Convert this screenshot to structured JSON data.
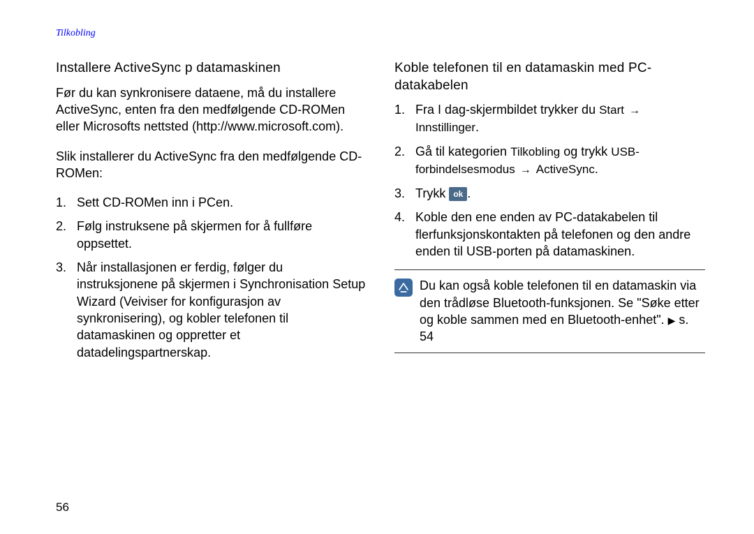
{
  "header": {
    "section_label": "Tilkobling"
  },
  "left": {
    "subheading": "Installere ActiveSync p datamaskinen",
    "intro": "Før du kan synkronisere dataene, må du installere ActiveSync, enten fra den medfølgende CD-ROMen eller Microsofts nettsted (http://www.microsoft.com).",
    "lead_in": "Slik installerer du ActiveSync fra den medfølgende CD-ROMen:",
    "steps": {
      "s1": "Sett CD-ROMen inn i PCen.",
      "s2": "Følg instruksene på skjermen for å fullføre oppsettet.",
      "s3": "Når installasjonen er ferdig, følger du instruksjonene på skjermen i Synchronisation Setup Wizard (Veiviser for konfigurasjon av synkronisering), og kobler telefonen til datamaskinen og oppretter et datadelingspartnerskap."
    }
  },
  "right": {
    "subheading": "Koble telefonen til en datamaskin med PC-datakabelen",
    "step1": {
      "pre": "Fra I dag-skjermbildet trykker du ",
      "ui1": "Start",
      "ui2": "Innstillinger",
      "post": "."
    },
    "step2": {
      "pre": "Gå til kategorien ",
      "ui1": "Tilkobling",
      "mid": " og trykk ",
      "ui2": "USB-forbindelsesmodus",
      "ui3": "ActiveSync",
      "post": "."
    },
    "step3": {
      "pre": "Trykk ",
      "ok": "ok",
      "post": "."
    },
    "step4": "Koble den ene enden av PC-datakabelen til flerfunksjonskontakten på telefonen og den andre enden til USB-porten på datamaskinen.",
    "note": {
      "text_pre": "Du kan også koble telefonen til en datamaskin via den trådløse Bluetooth-funksjonen. Se \"Søke etter og koble sammen med en Bluetooth-enhet\". ",
      "ref": "s. 54"
    }
  },
  "page_number": "56"
}
